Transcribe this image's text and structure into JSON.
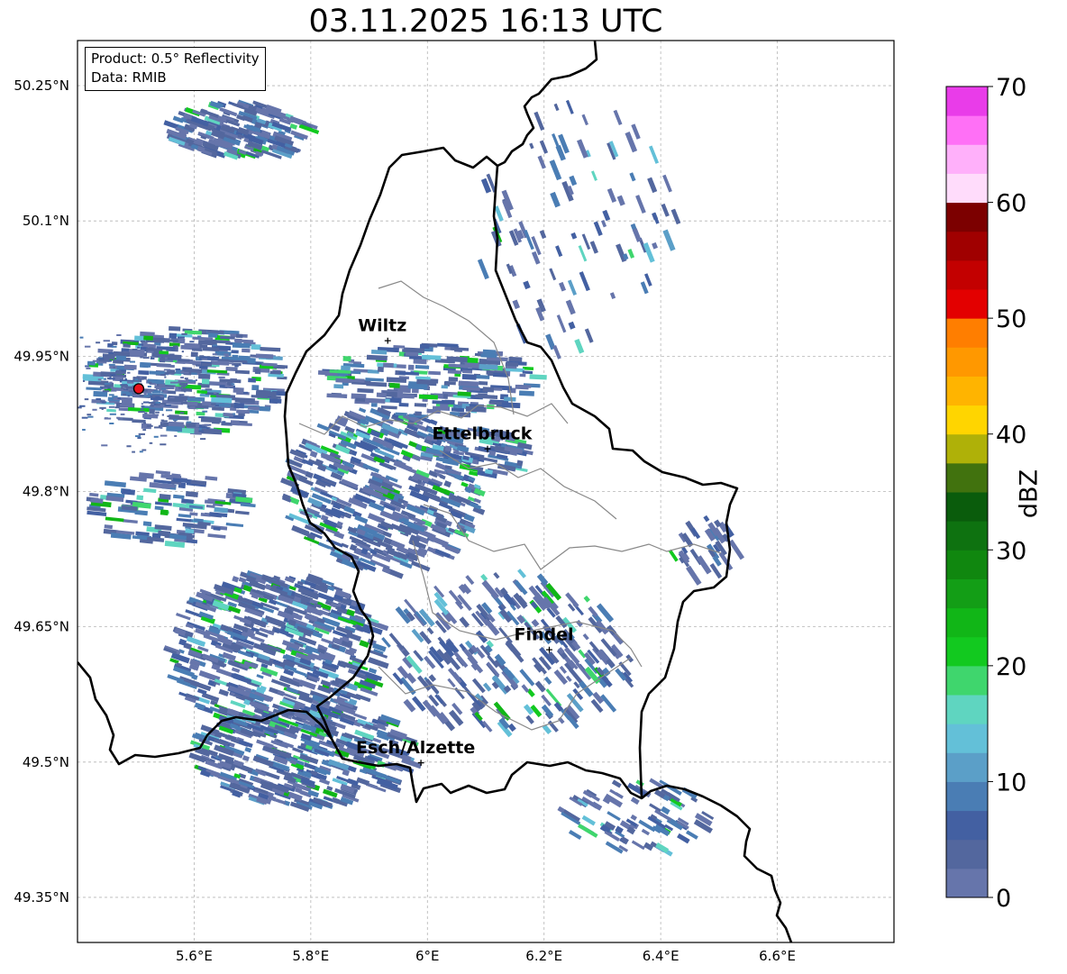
{
  "title": "03.11.2025 16:13 UTC",
  "info": {
    "product_line": "Product: 0.5° Reflectivity",
    "data_line": "Data: RMIB"
  },
  "map": {
    "lon_range": [
      5.4,
      6.8
    ],
    "lat_range": [
      49.3,
      50.3
    ],
    "lon_ticks": [
      5.6,
      5.8,
      6.0,
      6.2,
      6.4,
      6.6
    ],
    "lon_tick_labels": [
      "5.6°E",
      "5.8°E",
      "6°E",
      "6.2°E",
      "6.4°E",
      "6.6°E"
    ],
    "lat_ticks": [
      50.25,
      50.1,
      49.95,
      49.8,
      49.65,
      49.5,
      49.35
    ],
    "lat_tick_labels": [
      "50.25°N",
      "50.1°N",
      "49.95°N",
      "49.8°N",
      "49.65°N",
      "49.5°N",
      "49.35°N"
    ],
    "grid": true,
    "radar_site": {
      "lon": 5.505,
      "lat": 49.914,
      "color": "#e8141e"
    },
    "cities": [
      {
        "name": "Wiltz",
        "lon": 5.932,
        "lat": 49.968
      },
      {
        "name": "Ettelbruck",
        "lon": 6.103,
        "lat": 49.848
      },
      {
        "name": "Findel",
        "lon": 6.209,
        "lat": 49.625
      },
      {
        "name": "Esch/Alzette",
        "lon": 5.989,
        "lat": 49.5
      }
    ]
  },
  "colorbar": {
    "label": "dBZ",
    "min": 0,
    "max": 70,
    "tick_values": [
      0,
      10,
      20,
      30,
      40,
      50,
      60,
      70
    ],
    "tick_labels": [
      "0",
      "10",
      "20",
      "30",
      "40",
      "50",
      "60",
      "70"
    ],
    "colors": [
      "#6675ab",
      "#53679e",
      "#4360a2",
      "#4a7db4",
      "#5b9fc8",
      "#63c0d8",
      "#5fd5c0",
      "#3fd66d",
      "#12c91f",
      "#11b617",
      "#139e16",
      "#10870f",
      "#0e7210",
      "#0a5c0c",
      "#41720e",
      "#afb108",
      "#ffd500",
      "#ffb400",
      "#ff9800",
      "#ff7e00",
      "#e30000",
      "#c30000",
      "#a00000",
      "#7c0000",
      "#ffdcfb",
      "#ffb0fa",
      "#ff70f6",
      "#e93ce9"
    ]
  }
}
